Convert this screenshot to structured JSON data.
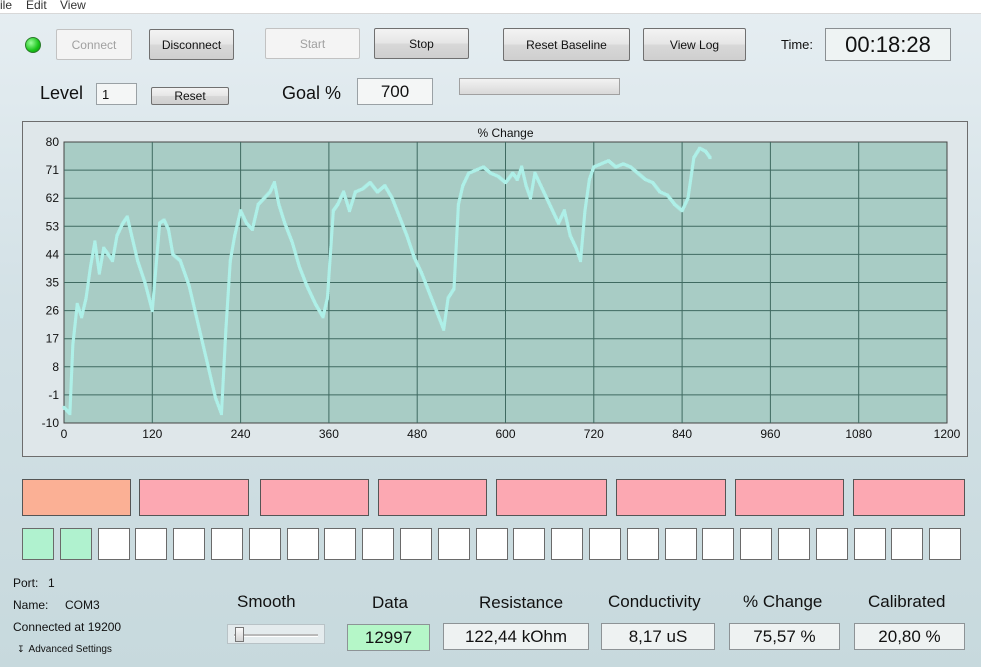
{
  "menu": {
    "file": "ile",
    "edit": "Edit",
    "view": "View"
  },
  "toolbar": {
    "connect": "Connect",
    "disconnect": "Disconnect",
    "start": "Start",
    "stop": "Stop",
    "reset_baseline": "Reset Baseline",
    "view_log": "View Log",
    "time_label": "Time:",
    "time_value": "00:18:28",
    "status_color": "#1fd41f"
  },
  "level": {
    "label": "Level",
    "value": "1",
    "reset": "Reset"
  },
  "goal": {
    "label": "Goal %",
    "value": "700",
    "progress_fraction": 0.0
  },
  "chart_data": {
    "type": "scatter",
    "title": "% Change",
    "xlabel": "",
    "ylabel": "",
    "xlim": [
      0,
      1200
    ],
    "ylim": [
      -10,
      80
    ],
    "x_ticks": [
      "0",
      "120",
      "240",
      "360",
      "480",
      "600",
      "720",
      "840",
      "960",
      "1080",
      "1200"
    ],
    "y_ticks": [
      "80",
      "71",
      "62",
      "53",
      "44",
      "35",
      "26",
      "17",
      "8",
      "-1",
      "-10"
    ],
    "grid": true,
    "point_color": "#aef0e8",
    "plot_bg": "#a8ccc5",
    "series": [
      {
        "points": [
          [
            0,
            -5
          ],
          [
            8,
            -7
          ],
          [
            12,
            15
          ],
          [
            18,
            28
          ],
          [
            24,
            24
          ],
          [
            30,
            30
          ],
          [
            36,
            40
          ],
          [
            42,
            48
          ],
          [
            48,
            38
          ],
          [
            54,
            46
          ],
          [
            60,
            44
          ],
          [
            66,
            42
          ],
          [
            72,
            50
          ],
          [
            80,
            54
          ],
          [
            86,
            56
          ],
          [
            92,
            50
          ],
          [
            100,
            42
          ],
          [
            110,
            35
          ],
          [
            120,
            26
          ],
          [
            130,
            54
          ],
          [
            136,
            55
          ],
          [
            142,
            52
          ],
          [
            148,
            44
          ],
          [
            158,
            42
          ],
          [
            170,
            34
          ],
          [
            182,
            22
          ],
          [
            194,
            10
          ],
          [
            206,
            -2
          ],
          [
            214,
            -7
          ],
          [
            220,
            20
          ],
          [
            226,
            42
          ],
          [
            232,
            50
          ],
          [
            240,
            58
          ],
          [
            248,
            54
          ],
          [
            256,
            52
          ],
          [
            264,
            60
          ],
          [
            272,
            62
          ],
          [
            280,
            64
          ],
          [
            286,
            67
          ],
          [
            292,
            60
          ],
          [
            300,
            54
          ],
          [
            310,
            48
          ],
          [
            320,
            40
          ],
          [
            330,
            34
          ],
          [
            342,
            28
          ],
          [
            352,
            24
          ],
          [
            358,
            30
          ],
          [
            366,
            58
          ],
          [
            372,
            60
          ],
          [
            380,
            64
          ],
          [
            388,
            58
          ],
          [
            396,
            64
          ],
          [
            406,
            65
          ],
          [
            416,
            67
          ],
          [
            426,
            64
          ],
          [
            436,
            66
          ],
          [
            446,
            62
          ],
          [
            456,
            56
          ],
          [
            466,
            50
          ],
          [
            476,
            43
          ],
          [
            486,
            38
          ],
          [
            496,
            32
          ],
          [
            506,
            26
          ],
          [
            516,
            20
          ],
          [
            522,
            30
          ],
          [
            530,
            33
          ],
          [
            536,
            60
          ],
          [
            542,
            66
          ],
          [
            550,
            70
          ],
          [
            560,
            71
          ],
          [
            570,
            72
          ],
          [
            580,
            70
          ],
          [
            590,
            69
          ],
          [
            600,
            67
          ],
          [
            610,
            70
          ],
          [
            616,
            68
          ],
          [
            622,
            72
          ],
          [
            628,
            66
          ],
          [
            634,
            62
          ],
          [
            640,
            70
          ],
          [
            648,
            66
          ],
          [
            656,
            62
          ],
          [
            664,
            58
          ],
          [
            672,
            54
          ],
          [
            680,
            58
          ],
          [
            688,
            50
          ],
          [
            696,
            46
          ],
          [
            702,
            42
          ],
          [
            708,
            58
          ],
          [
            714,
            68
          ],
          [
            720,
            72
          ],
          [
            730,
            73
          ],
          [
            740,
            74
          ],
          [
            750,
            72
          ],
          [
            760,
            73
          ],
          [
            770,
            72
          ],
          [
            780,
            70
          ],
          [
            790,
            68
          ],
          [
            800,
            67
          ],
          [
            810,
            64
          ],
          [
            820,
            63
          ],
          [
            830,
            60
          ],
          [
            840,
            58
          ],
          [
            848,
            62
          ],
          [
            856,
            75
          ],
          [
            864,
            78
          ],
          [
            872,
            77
          ],
          [
            878,
            75
          ]
        ]
      }
    ]
  },
  "bands": {
    "colors": [
      "#fbb095",
      "#fca8b2",
      "#fca8b2",
      "#fca8b2",
      "#fca8b2",
      "#fca8b2",
      "#fca8b2",
      "#fca8b2"
    ]
  },
  "cells": {
    "filled_count": 2,
    "filled_color": "#b0f2cf",
    "empty_color": "#ffffff"
  },
  "port": {
    "port_label": "Port:",
    "port_value": "1",
    "name_label": "Name:",
    "name_value": "COM3",
    "connected": "Connected at 19200",
    "advanced": "Advanced Settings"
  },
  "readouts": {
    "smooth_label": "Smooth",
    "smooth_level": 0.0,
    "data_label": "Data",
    "data_value": "12997",
    "data_color": "#b5f7c8",
    "resistance_label": "Resistance",
    "resistance_value": "122,44 kOhm",
    "conductivity_label": "Conductivity",
    "conductivity_value": "8,17 uS",
    "change_label": "% Change",
    "change_value": "75,57 %",
    "calibrated_label": "Calibrated",
    "calibrated_value": "20,80 %"
  }
}
